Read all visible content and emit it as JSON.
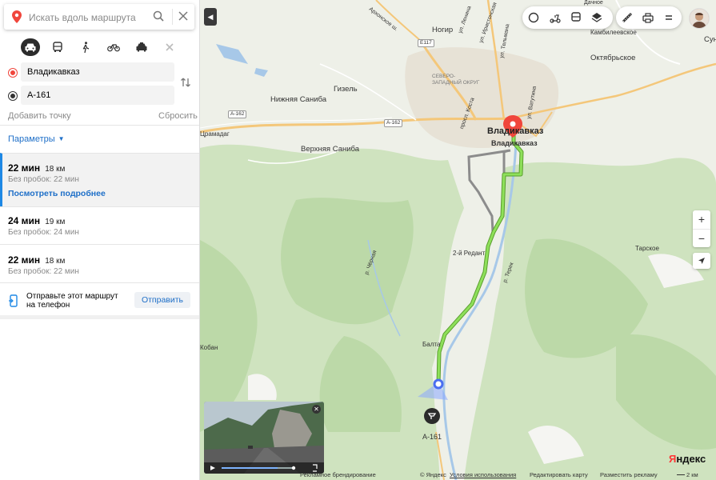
{
  "search": {
    "placeholder": "Искать вдоль маршрута"
  },
  "modes": [
    {
      "name": "car-icon",
      "selected": true
    },
    {
      "name": "bus-icon",
      "selected": false
    },
    {
      "name": "pedestrian-icon",
      "selected": false
    },
    {
      "name": "bicycle-icon",
      "selected": false
    },
    {
      "name": "taxi-icon",
      "selected": false
    },
    {
      "name": "close-icon",
      "selected": false
    }
  ],
  "route_points": {
    "from": "Владикавказ",
    "to": "А-161",
    "add_point": "Добавить точку",
    "reset": "Сбросить"
  },
  "params": {
    "label": "Параметры"
  },
  "routes": [
    {
      "time": "22 мин",
      "distance": "18 км",
      "no_traffic": "Без пробок: 22 мин",
      "details": "Посмотреть подробнее",
      "active": true
    },
    {
      "time": "24 мин",
      "distance": "19 км",
      "no_traffic": "Без пробок: 24 мин",
      "active": false
    },
    {
      "time": "22 мин",
      "distance": "18 км",
      "no_traffic": "Без пробок: 22 мин",
      "active": false
    }
  ],
  "send": {
    "text": "Отправьте этот маршрут на телефон",
    "button": "Отправить"
  },
  "map": {
    "labels": {
      "nogir": "Ногир",
      "kambileevskoe": "Камбилеевское",
      "oktyabrskoe": "Октябрьское",
      "gizel": "Гизель",
      "nizhnyaya_saniba": "Нижняя Саниба",
      "verkhnyaya_saniba": "Верхняя Саниба",
      "vladikavkaz": "Владикавказ",
      "vladikavkaz2": "Владикавказ",
      "severo_zapadny": "СЕВЕРО-ЗАПАДНЫЙ ОКРУГ",
      "redant": "2-й Редант",
      "tarskoe": "Тарское",
      "balta": "Балта",
      "a161": "А-161",
      "koban": "Кобан",
      "chernaya": "р. Чёрная",
      "terek": "р. Терек",
      "gramadag": "Црамадаг",
      "sun": "Сун",
      "dachnoe": "Дачное",
      "lenina": "ул. Ленина",
      "arkhonskoe": "Архонское ш.",
      "kosta": "просп. Коста",
      "irystonskaya": "ул. Иристонская",
      "telmana": "ул. Тельмана",
      "vatutina": "ул. Ватутина",
      "e117": "E117",
      "a162a": "А-162",
      "a162b": "А-162"
    }
  },
  "footer": {
    "ads_branding": "Рекламное брендирование",
    "copyright": "© Яндекс",
    "terms": "Условия использования",
    "edit_map": "Редактировать карту",
    "place_ad": "Разместить рекламу",
    "scale": "2 км"
  },
  "brand": {
    "logo_y": "Я",
    "logo_rest": "ндекс"
  },
  "colors": {
    "route": "#7ad04a",
    "alt_route": "#8c8c8c",
    "accent": "#1e88e5",
    "pin": "#f0463c"
  }
}
